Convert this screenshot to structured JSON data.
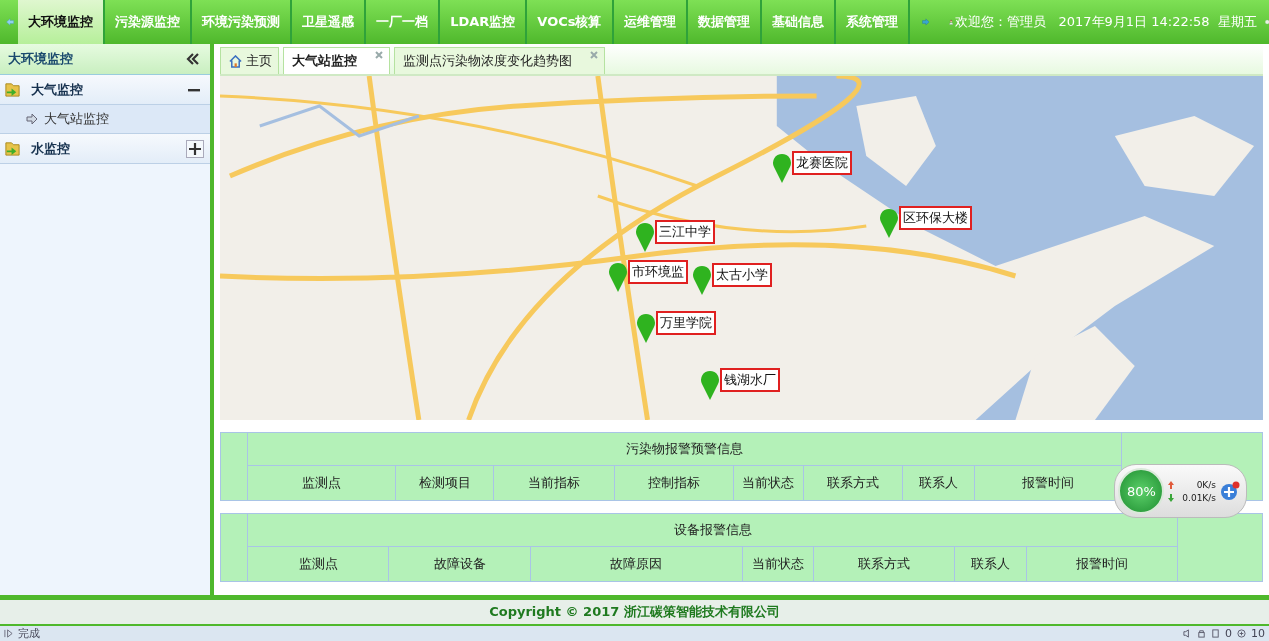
{
  "nav": {
    "items": [
      {
        "label": "大环境监控",
        "selected": true
      },
      {
        "label": "污染源监控",
        "selected": false
      },
      {
        "label": "环境污染预测",
        "selected": false
      },
      {
        "label": "卫星遥感",
        "selected": false
      },
      {
        "label": "一厂一档",
        "selected": false
      },
      {
        "label": "LDAR监控",
        "selected": false
      },
      {
        "label": "VOCs核算",
        "selected": false
      },
      {
        "label": "运维管理",
        "selected": false
      },
      {
        "label": "数据管理",
        "selected": false
      },
      {
        "label": "基础信息",
        "selected": false
      },
      {
        "label": "系统管理",
        "selected": false
      }
    ],
    "welcome": "欢迎您：管理员",
    "datetime": "2017年9月1日 14:22:58",
    "weekday": "星期五"
  },
  "sidebar": {
    "title": "大环境监控",
    "groups": [
      {
        "label": "大气监控",
        "expanded": true,
        "children": [
          {
            "label": "大气站监控",
            "selected": true
          }
        ]
      },
      {
        "label": "水监控",
        "expanded": false
      }
    ]
  },
  "tabs": [
    {
      "label": "主页",
      "selected": false,
      "closable": false,
      "home": true
    },
    {
      "label": "大气站监控",
      "selected": true,
      "closable": true,
      "home": false
    },
    {
      "label": "监测点污染物浓度变化趋势图",
      "selected": false,
      "closable": true,
      "home": false
    }
  ],
  "map": {
    "markers": [
      {
        "label": "龙赛医院"
      },
      {
        "label": "区环保大楼"
      },
      {
        "label": "三江中学"
      },
      {
        "label": "市环境监"
      },
      {
        "label": "太古小学"
      },
      {
        "label": "万里学院"
      },
      {
        "label": "钱湖水厂"
      }
    ]
  },
  "tables": [
    {
      "title": "污染物报警预警信息",
      "columns": [
        "监测点",
        "检测项目",
        "当前指标",
        "控制指标",
        "当前状态",
        "联系方式",
        "联系人",
        "报警时间"
      ]
    },
    {
      "title": "设备报警信息",
      "columns": [
        "监测点",
        "故障设备",
        "故障原因",
        "当前状态",
        "联系方式",
        "联系人",
        "报警时间"
      ]
    }
  ],
  "net_widget": {
    "percent": "80%",
    "upload": "0K/s",
    "download": "0.01K/s"
  },
  "footer": {
    "copyright": "Copyright © 2017 浙江碳策智能技术有限公司"
  },
  "status_bar": {
    "text": "完成",
    "count_1": "0",
    "count_2": "10"
  }
}
